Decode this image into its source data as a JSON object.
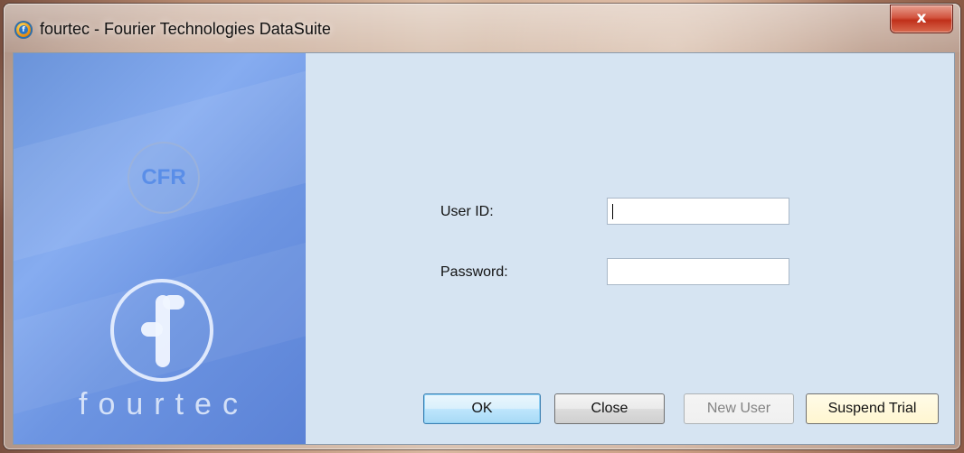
{
  "window": {
    "title": "fourtec - Fourier Technologies DataSuite",
    "close_label": "x"
  },
  "brand": {
    "badge": "CFR",
    "wordmark": "fourtec",
    "accent": "#5a8ee8"
  },
  "form": {
    "user_id_label": "User ID:",
    "user_id_value": "",
    "password_label": "Password:",
    "password_value": ""
  },
  "buttons": {
    "ok": "OK",
    "close": "Close",
    "new_user": "New User",
    "suspend_trial": "Suspend Trial"
  }
}
